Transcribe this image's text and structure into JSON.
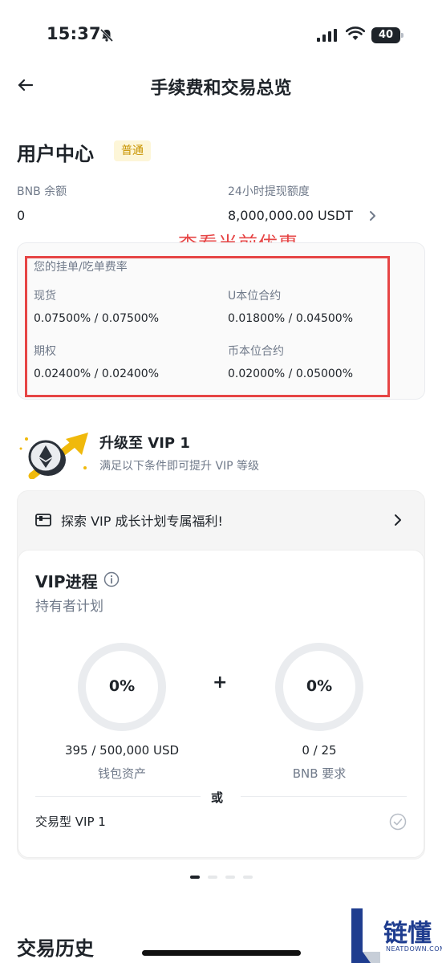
{
  "status_bar": {
    "time": "15:37",
    "battery": "40",
    "icons": [
      "bell-slash-icon",
      "signal-icon",
      "wifi-icon",
      "battery-icon"
    ]
  },
  "header": {
    "title": "手续费和交易总览",
    "back_icon": "back-arrow-icon"
  },
  "user_center": {
    "title": "用户中心",
    "tier": "普通",
    "bnb_label": "BNB 余额",
    "bnb_value": "0",
    "withdraw_label": "24小时提现额度",
    "withdraw_value": "8,000,000.00 USDT"
  },
  "annotation": {
    "text": "查看当前优惠",
    "color": "#e64545"
  },
  "fee_rates": {
    "heading": "您的挂单/吃单费率",
    "items": [
      {
        "label": "现货",
        "value": "0.07500% / 0.07500%"
      },
      {
        "label": "U本位合约",
        "value": "0.01800% / 0.04500%"
      },
      {
        "label": "期权",
        "value": "0.02400% / 0.02400%"
      },
      {
        "label": "币本位合约",
        "value": "0.02000% / 0.05000%"
      }
    ]
  },
  "upgrade": {
    "title": "升级至 VIP 1",
    "subtitle": "满足以下条件即可提升 VIP 等级",
    "accent": "#f0b90b"
  },
  "vip": {
    "explore_text": "探索 VIP 成长计划专属福利!",
    "title": "VIP进程",
    "subtitle": "持有者计划",
    "progress_left": {
      "percent_text": "0%",
      "progress": 0,
      "value": "395 / 500,000 USD",
      "label": "钱包资产"
    },
    "plus": "+",
    "progress_right": {
      "percent_text": "0%",
      "progress": 0,
      "value": "0 / 25",
      "label": "BNB 要求"
    },
    "or": "或",
    "trading_vip": "交易型 VIP 1"
  },
  "pagination": {
    "count": 4,
    "active": 0
  },
  "history": {
    "title": "交易历史"
  },
  "watermark": {
    "main": "链懂",
    "sub": "NEATDOWN.COM"
  }
}
